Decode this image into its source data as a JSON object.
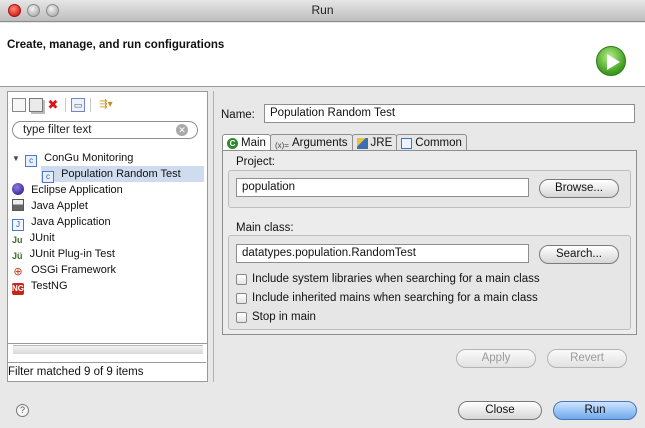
{
  "window": {
    "title": "Run"
  },
  "header": {
    "heading": "Create, manage, and run configurations"
  },
  "left": {
    "toolbar": [
      {
        "icon": "new-config-icon"
      },
      {
        "icon": "duplicate-config-icon"
      },
      {
        "icon": "delete-config-icon"
      },
      {
        "icon": "collapse-all-icon"
      },
      {
        "icon": "filter-menu-icon"
      }
    ],
    "filter": {
      "placeholder": "type filter text",
      "value": "type filter text"
    },
    "tree": [
      {
        "label": "ConGu Monitoring",
        "icon": "junit-config-icon",
        "expanded": true
      },
      {
        "label": "Population Random Test",
        "icon": "junit-config-icon",
        "selected": true
      },
      {
        "label": "Eclipse Application",
        "icon": "eclipse-app-icon"
      },
      {
        "label": "Java Applet",
        "icon": "java-applet-icon"
      },
      {
        "label": "Java Application",
        "icon": "java-app-icon"
      },
      {
        "label": "JUnit",
        "icon": "junit-icon",
        "glyph": "Ju"
      },
      {
        "label": "JUnit Plug-in Test",
        "icon": "junit-plugin-icon",
        "glyph": "Jü"
      },
      {
        "label": "OSGi Framework",
        "icon": "osgi-icon",
        "glyph": "⊕"
      },
      {
        "label": "TestNG",
        "icon": "testng-icon",
        "glyph": "NG"
      }
    ],
    "status": "Filter matched 9 of 9 items"
  },
  "editor": {
    "name_label": "Name:",
    "name_value": "Population Random Test",
    "tabs": [
      {
        "label": "Main",
        "active": true
      },
      {
        "label": "Arguments"
      },
      {
        "label": "JRE"
      },
      {
        "label": "Common"
      }
    ],
    "args_glyph": "(x)=",
    "project_label": "Project:",
    "project_value": "population",
    "browse_label": "Browse...",
    "main_class_label": "Main class:",
    "main_class_value": "datatypes.population.RandomTest",
    "search_label": "Search...",
    "checkboxes": [
      {
        "label": "Include system libraries when searching for a main class",
        "checked": false
      },
      {
        "label": "Include inherited mains when searching for a main class",
        "checked": false
      },
      {
        "label": "Stop in main",
        "checked": false
      }
    ],
    "apply_label": "Apply",
    "revert_label": "Revert"
  },
  "footer": {
    "help_glyph": "?",
    "close_label": "Close",
    "run_label": "Run"
  },
  "colors": {
    "selection": "#cfdcf0",
    "default_button": "#6fa8ec",
    "close_dot": "#d8281c",
    "run_logo": "#3a9a1c"
  }
}
